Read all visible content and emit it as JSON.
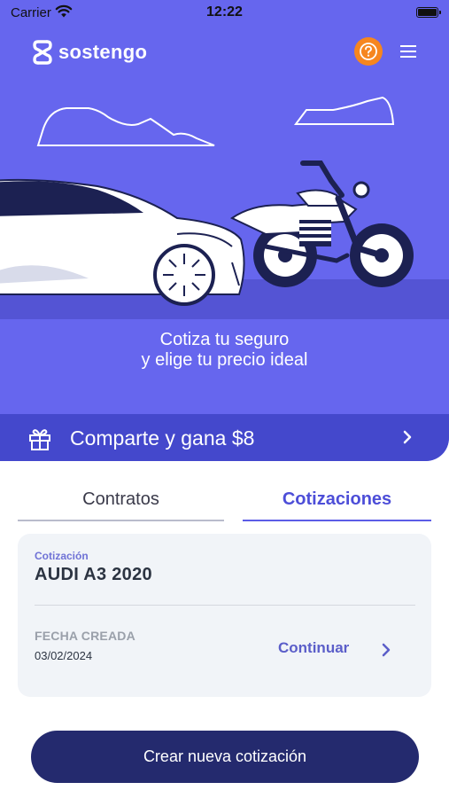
{
  "status_bar": {
    "carrier": "Carrier",
    "time": "12:22"
  },
  "header": {
    "brand": "sostengo",
    "help_icon": "question-circle-icon",
    "menu_icon": "hamburger-menu-icon"
  },
  "hero": {
    "line1": "Cotiza tu seguro",
    "line2": "y elige tu precio ideal"
  },
  "share_banner": {
    "label": "Comparte y gana $8",
    "icon": "gift-icon"
  },
  "tabs": [
    {
      "label": "Contratos",
      "active": false
    },
    {
      "label": "Cotizaciones",
      "active": true
    }
  ],
  "quote_card": {
    "kicker": "Cotización",
    "title": "AUDI A3 2020",
    "date_label": "FECHA CREADA",
    "date_value": "03/02/2024",
    "action_label": "Continuar"
  },
  "create_button": {
    "label": "Crear nueva cotización"
  },
  "colors": {
    "hero": "#6666ee",
    "banner": "#4448cc",
    "accent": "#5b5ce6",
    "help": "#f6861f",
    "primary_button": "#242a6e"
  }
}
